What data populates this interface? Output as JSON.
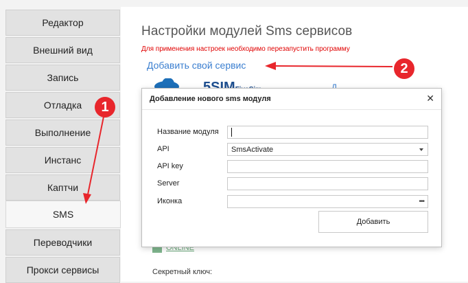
{
  "sidebar": {
    "items": [
      {
        "label": "Редактор"
      },
      {
        "label": "Внешний вид"
      },
      {
        "label": "Запись"
      },
      {
        "label": "Отладка"
      },
      {
        "label": "Выполнение"
      },
      {
        "label": "Инстанс"
      },
      {
        "label": "Каптчи"
      },
      {
        "label": "SMS",
        "active": true
      },
      {
        "label": "Переводчики"
      },
      {
        "label": "Прокси сервисы"
      }
    ]
  },
  "main": {
    "title": "Настройки модулей Sms сервисов",
    "warning": "Для применения настроек необходимо перезапустить программу",
    "add_service_link": "Добавить свой сервис",
    "service_logo_text": "5SIM",
    "service_logo_sub": "FiveSim",
    "background_link_fragment": "Д",
    "online_status": "ONLINE",
    "secret_key_label": "Секретный ключ:"
  },
  "dialog": {
    "title": "Добавление нового sms модуля",
    "fields": {
      "module_name": {
        "label": "Название модуля",
        "value": ""
      },
      "api": {
        "label": "API",
        "value": "SmsActivate"
      },
      "api_key": {
        "label": "API key",
        "value": ""
      },
      "server": {
        "label": "Server",
        "value": ""
      },
      "icon": {
        "label": "Иконка",
        "value": ""
      }
    },
    "add_button": "Добавить"
  },
  "annotations": {
    "badge1": "1",
    "badge2": "2"
  },
  "colors": {
    "accent_link": "#3b7fd0",
    "warning": "#e00000",
    "annotation": "#e8262c"
  },
  "icons": {
    "close": "close-icon",
    "dropdown": "chevron-down-icon",
    "browse": "ellipsis-icon"
  }
}
